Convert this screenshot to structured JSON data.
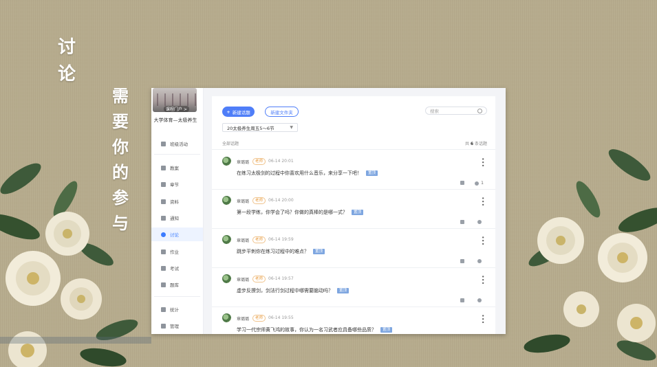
{
  "slide": {
    "title_col1": [
      "讨",
      "论"
    ],
    "title_col2": [
      "需",
      "要",
      "你",
      "的",
      "参",
      "与"
    ]
  },
  "sidebar": {
    "course_badge": "课程门户 >",
    "course_name": "大学体育—太极养生",
    "items": [
      {
        "label": "班级活动",
        "icon": "grid-icon"
      },
      {
        "label": "教案",
        "icon": "document-icon"
      },
      {
        "label": "章节",
        "icon": "list-icon"
      },
      {
        "label": "资料",
        "icon": "folder-icon"
      },
      {
        "label": "通知",
        "icon": "megaphone-icon"
      },
      {
        "label": "讨论",
        "icon": "chat-icon",
        "active": true
      },
      {
        "label": "作业",
        "icon": "pen-icon"
      },
      {
        "label": "考试",
        "icon": "exam-icon"
      },
      {
        "label": "题库",
        "icon": "stack-icon"
      },
      {
        "label": "统计",
        "icon": "pie-icon"
      },
      {
        "label": "管理",
        "icon": "gear-icon"
      }
    ]
  },
  "toolbar": {
    "new_topic": "新建话题",
    "new_folder": "新建文件夹",
    "search_placeholder": "搜索",
    "class_select": "20太极养生周五5～6节"
  },
  "list": {
    "section_label": "全部话题",
    "count_prefix": "共",
    "count_value": "6",
    "count_suffix": "条话题"
  },
  "posts": [
    {
      "author": "章璐璐",
      "role": "老师",
      "time": "06-14 20:01",
      "content": "在练习太极剑的过程中你喜欢用什么音乐，来分享一下吧！",
      "tag": "置顶",
      "comments": "1"
    },
    {
      "author": "章璐璐",
      "role": "老师",
      "time": "06-14 20:00",
      "content": "第一段学练，你学会了吗？你做的真棒的是哪一式？",
      "tag": "置顶",
      "comments": ""
    },
    {
      "author": "章璐璐",
      "role": "老师",
      "time": "06-14 19:59",
      "content": "跳步平刺你在练习过程中的难点？",
      "tag": "置顶",
      "comments": ""
    },
    {
      "author": "章璐璐",
      "role": "老师",
      "time": "06-14 19:57",
      "content": "虚步反撩剑，剑法行剑过程中哪需要脑动吗？",
      "tag": "置顶",
      "comments": ""
    },
    {
      "author": "章璐璐",
      "role": "老师",
      "time": "06-14 19:55",
      "content": "学习一代宗师黄飞鸿的故事，你认为一名习武者应具备哪些品质？",
      "tag": "置顶",
      "comments": ""
    }
  ]
}
